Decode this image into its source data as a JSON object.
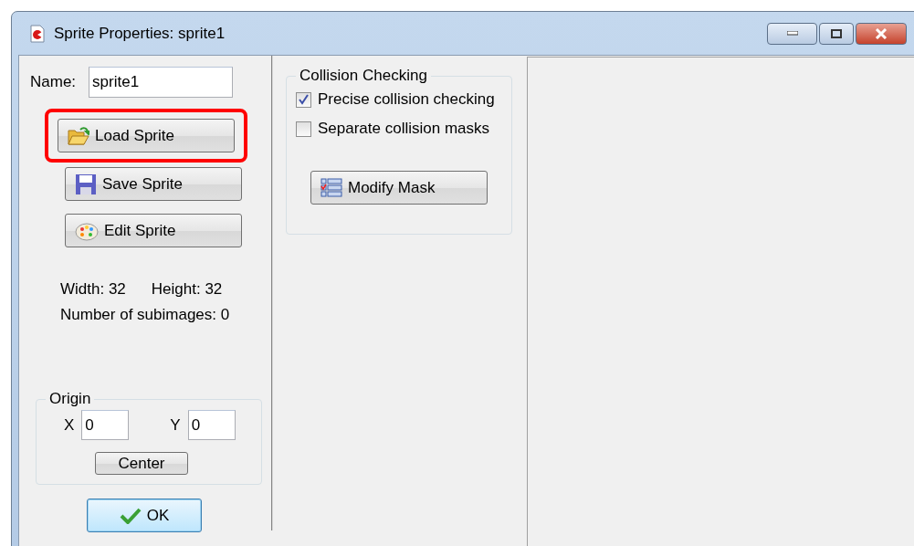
{
  "window": {
    "title": "Sprite Properties: sprite1"
  },
  "name_field": {
    "label": "Name:",
    "value": "sprite1"
  },
  "sprite_buttons": [
    {
      "label": "Load Sprite",
      "kind": "load",
      "highlighted": true
    },
    {
      "label": "Save Sprite",
      "kind": "save",
      "highlighted": false
    },
    {
      "label": "Edit Sprite",
      "kind": "edit",
      "highlighted": false
    }
  ],
  "info": {
    "width": "Width: 32",
    "height": "Height: 32",
    "subimages": "Number of subimages: 0"
  },
  "origin": {
    "title": "Origin",
    "x_label": "X",
    "x_value": "0",
    "y_label": "Y",
    "y_value": "0",
    "center_button": "Center"
  },
  "ok_button": "OK",
  "collision": {
    "title": "Collision Checking",
    "options": [
      {
        "label": "Precise collision checking",
        "checked": true
      },
      {
        "label": "Separate collision masks",
        "checked": false
      }
    ],
    "modify_button": "Modify Mask"
  }
}
